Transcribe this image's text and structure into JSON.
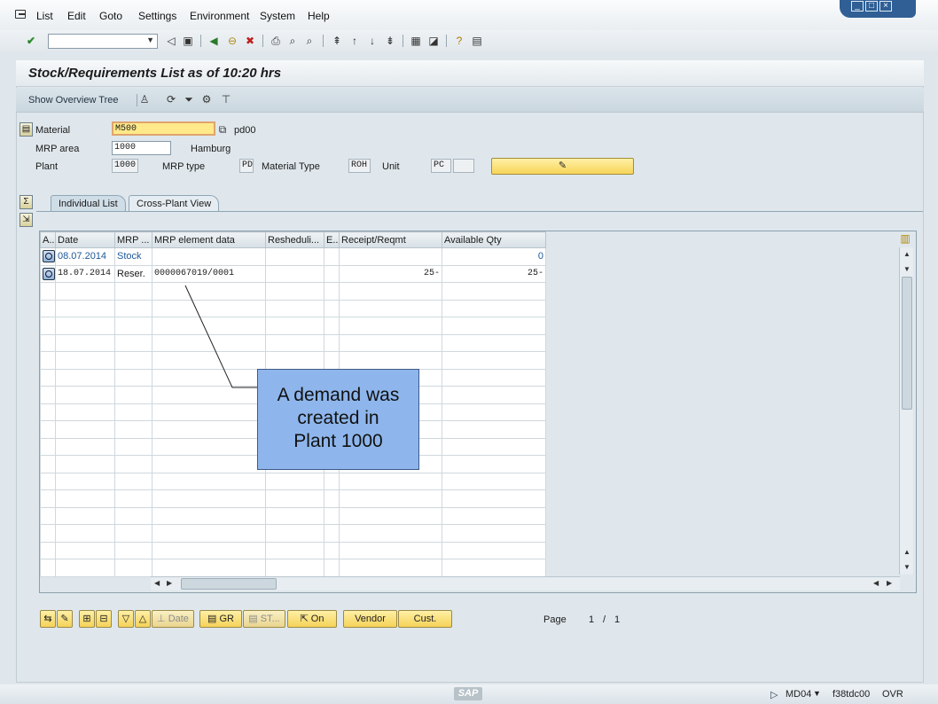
{
  "menubar": {
    "items": [
      "List",
      "Edit",
      "Goto",
      "Settings",
      "Environment",
      "System",
      "Help"
    ]
  },
  "standard_toolbar": {
    "command_field_value": ""
  },
  "title": "Stock/Requirements List as of 10:20 hrs",
  "app_toolbar": {
    "overview_tree_label": "Show Overview Tree"
  },
  "header": {
    "material_label": "Material",
    "material_value": "M500",
    "material_desc": "pd00",
    "mrp_area_label": "MRP area",
    "mrp_area_value": "1000",
    "mrp_area_desc": "Hamburg",
    "plant_label": "Plant",
    "plant_value": "1000",
    "mrp_type_label": "MRP type",
    "mrp_type_value": "PD",
    "material_type_label": "Material Type",
    "material_type_value": "ROH",
    "unit_label": "Unit",
    "unit_value": "PC"
  },
  "tabs": [
    "Individual List",
    "Cross-Plant View"
  ],
  "grid": {
    "columns": [
      "A..",
      "Date",
      "MRP ...",
      "MRP element data",
      "Resheduli...",
      "E..",
      "Receipt/Reqmt",
      "Available Qty"
    ],
    "rows": [
      {
        "date": "08.07.2014",
        "mrp": "Stock",
        "element_data": "",
        "rescheduling": "",
        "e": "",
        "receipt": "",
        "available": "0"
      },
      {
        "date": "18.07.2014",
        "mrp": "Reser.",
        "element_data": "0000067019/0001",
        "rescheduling": "",
        "e": "",
        "receipt": "25-",
        "available": "25-"
      }
    ]
  },
  "callout": {
    "line1": "A demand was",
    "line2": "created in",
    "line3": "Plant 1000"
  },
  "bottom_buttons": {
    "date": "Date",
    "gr": "GR",
    "st": "ST...",
    "on": "On",
    "vendor": "Vendor",
    "cust": "Cust."
  },
  "paging": {
    "label": "Page",
    "current": "1",
    "sep": "/",
    "total": "1"
  },
  "status": {
    "transaction": "MD04",
    "server": "f38tdc00",
    "mode": "OVR"
  },
  "colors": {
    "accent_yellow": "#f7d55a",
    "callout_fill": "#8eb6ec",
    "link_blue": "#20599a"
  }
}
